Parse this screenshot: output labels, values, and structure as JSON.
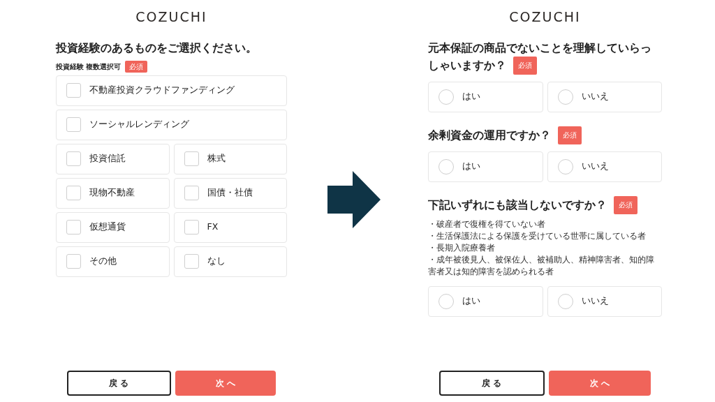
{
  "screens": [
    {
      "logo": "COZUCHI",
      "questions": [
        {
          "title": "投資経験のあるものをご選択ください。",
          "label": "投資経験 複数選択可",
          "required": "必須",
          "kind": "checkbox",
          "options": [
            {
              "label": "不動産投資クラウドファンディング",
              "wide": true,
              "checked": false
            },
            {
              "label": "ソーシャルレンディング",
              "wide": true,
              "checked": false
            },
            {
              "label": "投資信託",
              "wide": false,
              "checked": false
            },
            {
              "label": "株式",
              "wide": false,
              "checked": false
            },
            {
              "label": "現物不動産",
              "wide": false,
              "checked": false
            },
            {
              "label": "国債・社債",
              "wide": false,
              "checked": false
            },
            {
              "label": "仮想通貨",
              "wide": false,
              "checked": false
            },
            {
              "label": "FX",
              "wide": false,
              "checked": false
            },
            {
              "label": "その他",
              "wide": false,
              "checked": false
            },
            {
              "label": "なし",
              "wide": false,
              "checked": false
            }
          ]
        }
      ],
      "buttons": [
        {
          "label": "戻 る",
          "kind": "back"
        },
        {
          "label": "次 へ",
          "kind": "next"
        }
      ]
    },
    {
      "logo": "COZUCHI",
      "questions": [
        {
          "title": "元本保証の商品でないことを理解していらっしゃいますか？",
          "required": "必須",
          "kind": "radio",
          "options": [
            {
              "label": "はい",
              "wide": false,
              "checked": false
            },
            {
              "label": "いいえ",
              "wide": false,
              "checked": false
            }
          ]
        },
        {
          "title": "余剰資金の運用ですか？",
          "required": "必須",
          "kind": "radio",
          "options": [
            {
              "label": "はい",
              "wide": false,
              "checked": false
            },
            {
              "label": "いいえ",
              "wide": false,
              "checked": false
            }
          ]
        },
        {
          "title": "下記いずれにも該当しないですか？",
          "required": "必須",
          "kind": "radio",
          "notes": [
            "・破産者で復権を得ていない者",
            "・生活保護法による保護を受けている世帯に属している者",
            "・長期入院療養者",
            "・成年被後見人、被保佐人、被補助人、精神障害者、知的障害者又は知的障害を認められる者"
          ],
          "options": [
            {
              "label": "はい",
              "wide": false,
              "checked": false
            },
            {
              "label": "いいえ",
              "wide": false,
              "checked": false
            }
          ]
        }
      ],
      "buttons": [
        {
          "label": "戻 る",
          "kind": "back"
        },
        {
          "label": "次 へ",
          "kind": "next"
        }
      ]
    }
  ]
}
